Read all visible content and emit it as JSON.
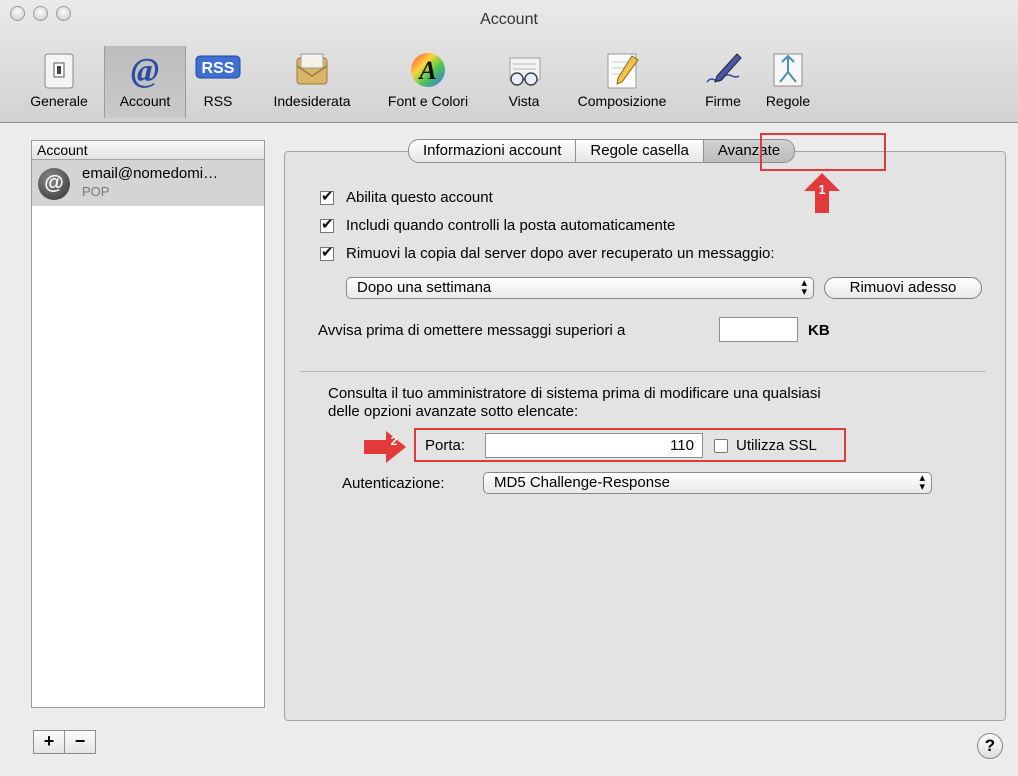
{
  "window": {
    "title": "Account"
  },
  "toolbar": {
    "items": [
      {
        "label": "Generale",
        "icon": "general-switch-icon"
      },
      {
        "label": "Account",
        "icon": "at-sign-icon"
      },
      {
        "label": "RSS",
        "icon": "rss-icon"
      },
      {
        "label": "Indesiderata",
        "icon": "junk-mail-icon"
      },
      {
        "label": "Font e Colori",
        "icon": "font-colors-icon"
      },
      {
        "label": "Vista",
        "icon": "glasses-icon"
      },
      {
        "label": "Composizione",
        "icon": "compose-pencil-icon"
      },
      {
        "label": "Firme",
        "icon": "signature-pen-icon"
      },
      {
        "label": "Regole",
        "icon": "rules-arrows-icon"
      }
    ],
    "rss_badge": "RSS",
    "font_glyph": "A",
    "selected": "Account"
  },
  "sidebar": {
    "header": "Account",
    "accounts": [
      {
        "email": "email@nomedomi…",
        "type": "POP",
        "avatar": "@"
      }
    ],
    "add_label": "+",
    "remove_label": "−"
  },
  "tabs": [
    {
      "label": "Informazioni account",
      "active": false
    },
    {
      "label": "Regole casella",
      "active": false
    },
    {
      "label": "Avanzate",
      "active": true
    }
  ],
  "advanced": {
    "enable_account": {
      "label": "Abilita questo account",
      "checked": true
    },
    "include_auto_check": {
      "label": "Includi quando controlli la posta automaticamente",
      "checked": true
    },
    "remove_copy": {
      "label": "Rimuovi la copia dal server dopo aver recuperato un messaggio:",
      "checked": true
    },
    "remove_after": "Dopo una settimana",
    "remove_now_button": "Rimuovi adesso",
    "warn_label": "Avvisa prima di omettere messaggi superiori a",
    "warn_value": "",
    "warn_unit": "KB",
    "admin_note_line1": "Consulta il tuo amministratore di sistema prima di modificare una qualsiasi",
    "admin_note_line2": "delle opzioni avanzate sotto elencate:",
    "port_label": "Porta:",
    "port_value": "110",
    "ssl": {
      "label": "Utilizza SSL",
      "checked": false
    },
    "auth_label": "Autenticazione:",
    "auth_value": "MD5 Challenge-Response"
  },
  "annotations": {
    "marker1": "1",
    "marker2": "2",
    "color": "#e23a3a"
  },
  "help_label": "?"
}
